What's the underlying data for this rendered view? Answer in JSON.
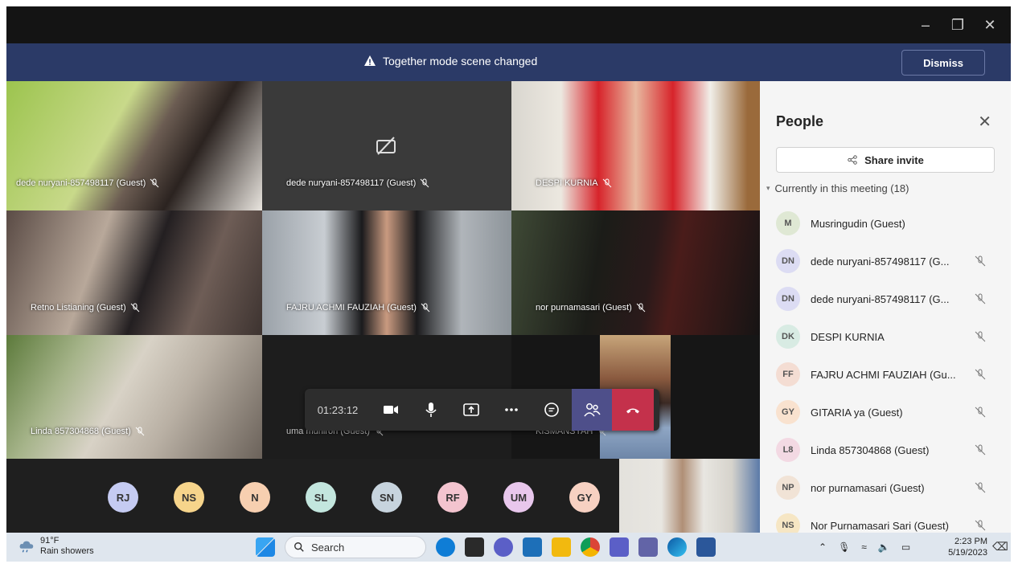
{
  "window": {
    "minimize_icon": "minimize-icon",
    "restore_icon": "restore-icon",
    "close_icon": "close-icon"
  },
  "notification": {
    "text": "Together mode scene changed",
    "dismiss_label": "Dismiss",
    "icon": "warning-icon"
  },
  "tiles": [
    {
      "name": "dede nuryani-857498117 (Guest)",
      "muted": true
    },
    {
      "name": "dede nuryani-857498117 (Guest)",
      "muted": true,
      "camera_off": true
    },
    {
      "name": "DESPI KURNIA",
      "muted": true
    },
    {
      "name": "Retno Listianing (Guest)",
      "muted": true
    },
    {
      "name": "FAJRU ACHMI FAUZIAH (Guest)",
      "muted": true
    },
    {
      "name": "nor purnamasari (Guest)",
      "muted": true
    },
    {
      "name": "Linda 857304868 (Guest)",
      "muted": true
    },
    {
      "name": "uma muniron (Guest)",
      "muted": true
    },
    {
      "name": "KISMANSYAH",
      "muted": true
    }
  ],
  "controls": {
    "timer": "01:23:12",
    "icons": [
      "camera-icon",
      "microphone-icon",
      "share-screen-icon",
      "more-icon",
      "chat-icon",
      "people-icon",
      "hang-up-icon"
    ]
  },
  "avatar_row": [
    {
      "initials": "RJ",
      "color": "#c5cbf2"
    },
    {
      "initials": "NS",
      "color": "#f6d48b"
    },
    {
      "initials": "N",
      "color": "#f7cfb0"
    },
    {
      "initials": "SL",
      "color": "#c3e6de"
    },
    {
      "initials": "SN",
      "color": "#c7d4de"
    },
    {
      "initials": "RF",
      "color": "#f3c4cf"
    },
    {
      "initials": "UM",
      "color": "#e8c7ec"
    },
    {
      "initials": "GY",
      "color": "#f7d1c2"
    }
  ],
  "people_panel": {
    "title": "People",
    "share_label": "Share invite",
    "section": "Currently in this meeting (18)",
    "people": [
      {
        "initials": "M",
        "name": "Musringudin (Guest)",
        "color": "#dfe8d4",
        "muted": false
      },
      {
        "initials": "DN",
        "name": "dede nuryani-857498117 (G...",
        "color": "#dcdcf3",
        "muted": true
      },
      {
        "initials": "DN",
        "name": "dede nuryani-857498117 (G...",
        "color": "#dcdcf3",
        "muted": true
      },
      {
        "initials": "DK",
        "name": "DESPI KURNIA",
        "color": "#d8ebe3",
        "muted": true
      },
      {
        "initials": "FF",
        "name": "FAJRU ACHMI FAUZIAH (Gu...",
        "color": "#f4ddd3",
        "muted": true
      },
      {
        "initials": "GY",
        "name": "GITARIA ya (Guest)",
        "color": "#f9e2cf",
        "muted": true
      },
      {
        "initials": "L8",
        "name": "Linda 857304868 (Guest)",
        "color": "#f3d9e3",
        "muted": true
      },
      {
        "initials": "NP",
        "name": "nor purnamasari (Guest)",
        "color": "#f1e3d6",
        "muted": true
      },
      {
        "initials": "NS",
        "name": "Nor Purnamasari Sari (Guest)",
        "color": "#f6e6c4",
        "muted": true
      }
    ]
  },
  "taskbar": {
    "temperature": "91°F",
    "weather": "Rain showers",
    "search_label": "Search",
    "time": "2:23 PM",
    "date": "5/19/2023"
  }
}
